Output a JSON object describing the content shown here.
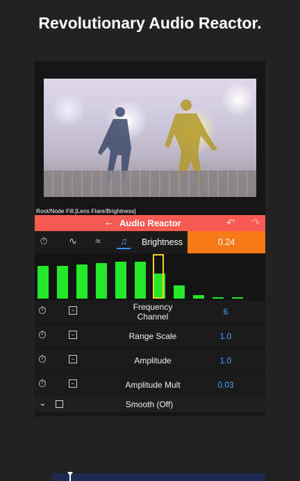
{
  "headline": "Revolutionary Audio Reactor.",
  "node_path": "Root/Node Fill.[Lens Flare/Brightness]",
  "toolbar": {
    "title": "Audio Reactor",
    "back_icon": "arrow-left-icon",
    "undo_icon": "undo-icon",
    "redo_icon": "redo-icon"
  },
  "tabs": {
    "items": [
      {
        "icon": "timer-icon"
      },
      {
        "icon": "graph-icon"
      },
      {
        "icon": "wave-icon"
      },
      {
        "icon": "music-note-icon",
        "active": true
      }
    ],
    "param_label": "Brightness",
    "param_value": "0.24"
  },
  "spectrum": {
    "levels": [
      0.74,
      0.74,
      0.77,
      0.8,
      0.83,
      0.83,
      0.56,
      0.29,
      0.08,
      0.02,
      0.02
    ],
    "selected_index": 6,
    "colors": {
      "bar": "#25e82a",
      "selected": "#f0d71c"
    }
  },
  "params": [
    {
      "label": "Frequency\nChannel",
      "value": "6"
    },
    {
      "label": "Range Scale",
      "value": "1.0"
    },
    {
      "label": "Amplitude",
      "value": "1.0"
    },
    {
      "label": "Amplitude Mult",
      "value": "0.03"
    }
  ],
  "smooth": {
    "label": "Smooth (Off)",
    "checked": false
  },
  "colors": {
    "accent": "#f65a52",
    "value_highlight": "#f77a16",
    "value_text": "#4aa0ff"
  }
}
